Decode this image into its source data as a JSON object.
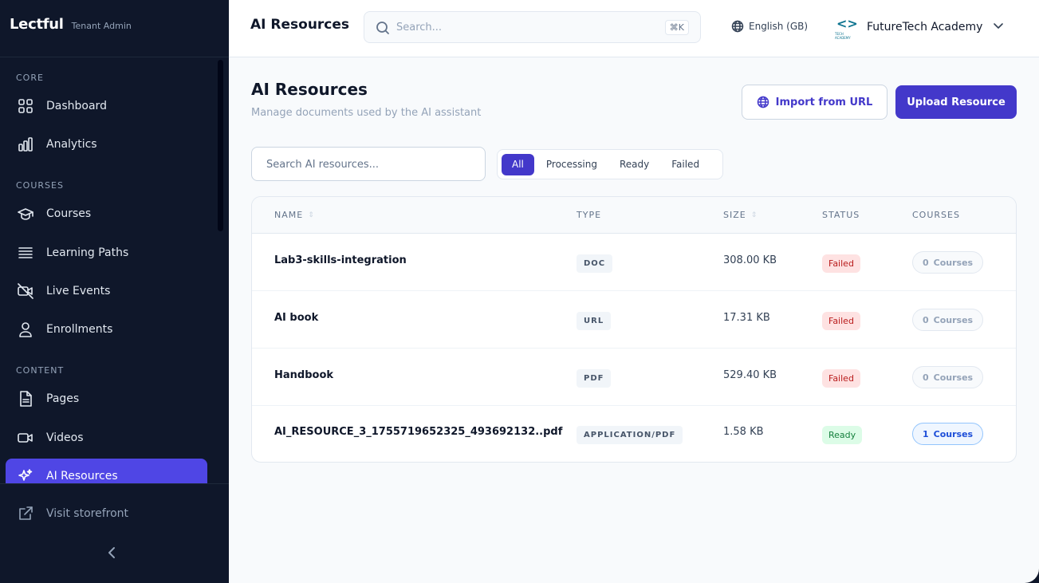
{
  "brand": {
    "name": "Lectful",
    "role": "Tenant Admin"
  },
  "sidebar": {
    "sections": [
      {
        "label": "CORE"
      },
      {
        "label": "COURSES"
      },
      {
        "label": "CONTENT"
      }
    ],
    "items": [
      {
        "label": "Dashboard",
        "icon": "grid-icon"
      },
      {
        "label": "Analytics",
        "icon": "bar-chart-icon"
      },
      {
        "label": "Courses",
        "icon": "graduation-cap-icon"
      },
      {
        "label": "Learning Paths",
        "icon": "list-icon"
      },
      {
        "label": "Live Events",
        "icon": "video-off-icon"
      },
      {
        "label": "Enrollments",
        "icon": "user-icon"
      },
      {
        "label": "Pages",
        "icon": "file-icon"
      },
      {
        "label": "Videos",
        "icon": "video-icon"
      },
      {
        "label": "AI Resources",
        "icon": "sparkles-icon",
        "active": true
      }
    ],
    "visit_storefront": "Visit storefront"
  },
  "topbar": {
    "title": "AI Resources",
    "search_placeholder": "Search...",
    "shortcut": "⌘K",
    "language": "English (GB)",
    "org_name": "FutureTech Academy",
    "org_logo_glyph": "<>",
    "org_logo_caption": "TECH ACADEMY"
  },
  "page": {
    "title": "AI Resources",
    "subtitle": "Manage documents used by the AI assistant",
    "import_button": "Import from URL",
    "upload_button": "Upload Resource",
    "search_placeholder": "Search AI resources...",
    "filters": [
      "All",
      "Processing",
      "Ready",
      "Failed"
    ],
    "active_filter": "All"
  },
  "table": {
    "columns": [
      "NAME",
      "TYPE",
      "SIZE",
      "STATUS",
      "COURSES"
    ],
    "rows": [
      {
        "name": "Lab3-skills-integration",
        "type": "DOC",
        "size": "308.00 KB",
        "status": "Failed",
        "courses_count": "0",
        "courses_label": "Courses"
      },
      {
        "name": "AI book",
        "type": "URL",
        "size": "17.31 KB",
        "status": "Failed",
        "courses_count": "0",
        "courses_label": "Courses"
      },
      {
        "name": "Handbook",
        "type": "PDF",
        "size": "529.40 KB",
        "status": "Failed",
        "courses_count": "0",
        "courses_label": "Courses"
      },
      {
        "name": "AI_RESOURCE_3_1755719652325_493692132..pdf",
        "type": "APPLICATION/PDF",
        "size": "1.58 KB",
        "status": "Ready",
        "courses_count": "1",
        "courses_label": "Courses"
      }
    ]
  },
  "colors": {
    "accent": "#4338ca",
    "sidebar_bg": "#0f172a",
    "failed": "#b91c1c",
    "ready": "#15803d"
  }
}
